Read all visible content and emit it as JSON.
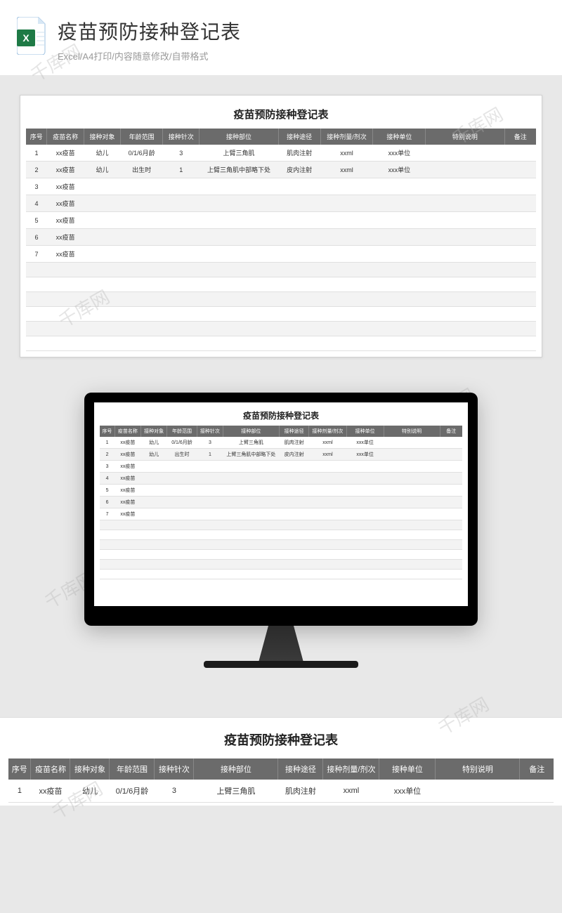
{
  "header": {
    "title": "疫苗预防接种登记表",
    "subtitle": "Excel/A4打印/内容随意修改/自带格式"
  },
  "watermark": "千库网",
  "sheet": {
    "title": "疫苗预防接种登记表",
    "columns": [
      "序号",
      "疫苗名称",
      "接种对象",
      "年龄范围",
      "接种针次",
      "接种部位",
      "接种途径",
      "接种剂量/剂次",
      "接种单位",
      "特别说明",
      "备注"
    ],
    "rows": [
      {
        "seq": "1",
        "name": "xx疫苗",
        "target": "幼儿",
        "age": "0/1/6月龄",
        "times": "3",
        "site": "上臂三角肌",
        "route": "肌肉注射",
        "dose": "xxml",
        "unit": "xxx单位",
        "note": "",
        "remark": ""
      },
      {
        "seq": "2",
        "name": "xx疫苗",
        "target": "幼儿",
        "age": "出生时",
        "times": "1",
        "site": "上臂三角肌中部略下处",
        "route": "皮内注射",
        "dose": "xxml",
        "unit": "xxx单位",
        "note": "",
        "remark": ""
      },
      {
        "seq": "3",
        "name": "xx疫苗",
        "target": "",
        "age": "",
        "times": "",
        "site": "",
        "route": "",
        "dose": "",
        "unit": "",
        "note": "",
        "remark": ""
      },
      {
        "seq": "4",
        "name": "xx疫苗",
        "target": "",
        "age": "",
        "times": "",
        "site": "",
        "route": "",
        "dose": "",
        "unit": "",
        "note": "",
        "remark": ""
      },
      {
        "seq": "5",
        "name": "xx疫苗",
        "target": "",
        "age": "",
        "times": "",
        "site": "",
        "route": "",
        "dose": "",
        "unit": "",
        "note": "",
        "remark": ""
      },
      {
        "seq": "6",
        "name": "xx疫苗",
        "target": "",
        "age": "",
        "times": "",
        "site": "",
        "route": "",
        "dose": "",
        "unit": "",
        "note": "",
        "remark": ""
      },
      {
        "seq": "7",
        "name": "xx疫苗",
        "target": "",
        "age": "",
        "times": "",
        "site": "",
        "route": "",
        "dose": "",
        "unit": "",
        "note": "",
        "remark": ""
      },
      {
        "seq": "",
        "name": "",
        "target": "",
        "age": "",
        "times": "",
        "site": "",
        "route": "",
        "dose": "",
        "unit": "",
        "note": "",
        "remark": ""
      },
      {
        "seq": "",
        "name": "",
        "target": "",
        "age": "",
        "times": "",
        "site": "",
        "route": "",
        "dose": "",
        "unit": "",
        "note": "",
        "remark": ""
      },
      {
        "seq": "",
        "name": "",
        "target": "",
        "age": "",
        "times": "",
        "site": "",
        "route": "",
        "dose": "",
        "unit": "",
        "note": "",
        "remark": ""
      },
      {
        "seq": "",
        "name": "",
        "target": "",
        "age": "",
        "times": "",
        "site": "",
        "route": "",
        "dose": "",
        "unit": "",
        "note": "",
        "remark": ""
      },
      {
        "seq": "",
        "name": "",
        "target": "",
        "age": "",
        "times": "",
        "site": "",
        "route": "",
        "dose": "",
        "unit": "",
        "note": "",
        "remark": ""
      },
      {
        "seq": "",
        "name": "",
        "target": "",
        "age": "",
        "times": "",
        "site": "",
        "route": "",
        "dose": "",
        "unit": "",
        "note": "",
        "remark": ""
      }
    ]
  },
  "bottom_rows": [
    {
      "seq": "1",
      "name": "xx疫苗",
      "target": "幼儿",
      "age": "0/1/6月龄",
      "times": "3",
      "site": "上臂三角肌",
      "route": "肌肉注射",
      "dose": "xxml",
      "unit": "xxx单位",
      "note": "",
      "remark": ""
    }
  ]
}
